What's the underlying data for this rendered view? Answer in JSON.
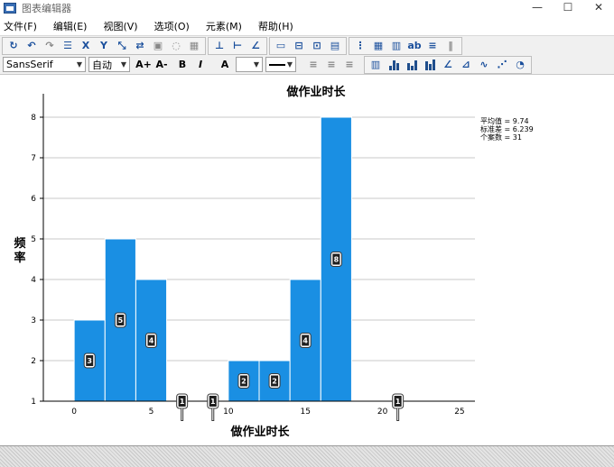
{
  "window": {
    "title": "图表编辑器",
    "minimize": "—",
    "maximize": "☐",
    "close": "✕"
  },
  "menu": [
    "文件(F)",
    "编辑(E)",
    "视图(V)",
    "选项(O)",
    "元素(M)",
    "帮助(H)"
  ],
  "format_toolbar": {
    "font_family": "SansSerif",
    "font_size": "自动",
    "grow_label": "A+",
    "shrink_label": "A-",
    "bold_label": "B",
    "italic_label": "I",
    "text_color_label": "A"
  },
  "colors": {
    "bar": "#1a8fe3",
    "grid": "#c8c8c8",
    "axis": "#000000"
  },
  "chart_data": {
    "type": "bar",
    "title": "做作业时长",
    "xlabel": "做作业时长",
    "ylabel": "频率",
    "xlim": [
      -2,
      26
    ],
    "ylim": [
      1,
      8
    ],
    "xticks": [
      0,
      5,
      10,
      15,
      20,
      25
    ],
    "yticks": [
      1,
      2,
      3,
      4,
      5,
      6,
      7,
      8
    ],
    "grid": true,
    "bins": [
      {
        "x0": 0,
        "x1": 2,
        "count": 3,
        "label": "3"
      },
      {
        "x0": 2,
        "x1": 4,
        "count": 5,
        "label": "5"
      },
      {
        "x0": 4,
        "x1": 6,
        "count": 4,
        "label": "4"
      },
      {
        "x0": 6,
        "x1": 8,
        "count": 1,
        "label": "1"
      },
      {
        "x0": 8,
        "x1": 10,
        "count": 1,
        "label": "1"
      },
      {
        "x0": 10,
        "x1": 12,
        "count": 2,
        "label": "2"
      },
      {
        "x0": 12,
        "x1": 14,
        "count": 2,
        "label": "2"
      },
      {
        "x0": 14,
        "x1": 16,
        "count": 4,
        "label": "4"
      },
      {
        "x0": 16,
        "x1": 18,
        "count": 8,
        "label": "8"
      },
      {
        "x0": 20,
        "x1": 22,
        "count": 1,
        "label": "1"
      }
    ],
    "stats": [
      "平均值 = 9.74",
      "标准差 = 6.239",
      "个案数 = 31"
    ]
  }
}
